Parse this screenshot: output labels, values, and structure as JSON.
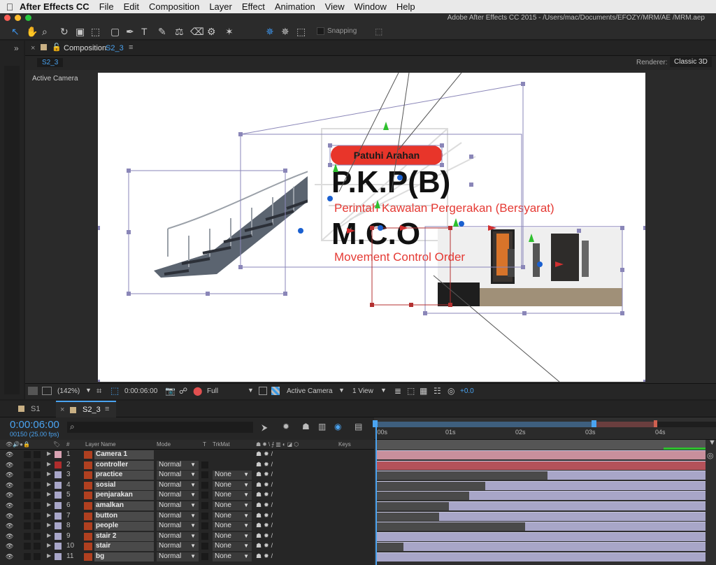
{
  "menubar": {
    "app_name": "After Effects CC",
    "items": [
      "File",
      "Edit",
      "Composition",
      "Layer",
      "Effect",
      "Animation",
      "View",
      "Window",
      "Help"
    ]
  },
  "window": {
    "title": "Adobe After Effects CC 2015 - /Users/mac/Documents/EFOZY/MRM/AE /MRM.aep"
  },
  "toolbar": {
    "snapping_label": "Snapping"
  },
  "composition_panel": {
    "tab_label": "Composition",
    "tab_name": "S2_3",
    "breadcrumb": "S2_3",
    "renderer_label": "Renderer:",
    "renderer_value": "Classic 3D",
    "active_camera_label": "Active Camera"
  },
  "canvas_text": {
    "banner": "Patuhi Arahan",
    "title1": "P.K.P(B)",
    "subtitle1": "Perintah Kawalan Pergerakan (Bersyarat)",
    "title2": "M.C.O",
    "subtitle2": "Movement Control Order"
  },
  "viewer_bar": {
    "zoom": "(142%)",
    "timecode": "0:00:06:00",
    "resolution": "Full",
    "view": "Active Camera",
    "view_count": "1 View",
    "exposure": "+0.0"
  },
  "timeline": {
    "tabs": [
      {
        "label": "S1"
      },
      {
        "label": "S2_3"
      }
    ],
    "current_time": "0:00:06:00",
    "frames_info": "00150 (25.00 fps)",
    "columns": {
      "layer_name": "Layer Name",
      "mode": "Mode",
      "t": "T",
      "trkmat": "TrkMat",
      "keys": "Keys"
    },
    "ruler_labels": [
      ":00s",
      "01s",
      "02s",
      "03s",
      "04s"
    ],
    "layers": [
      {
        "num": "1",
        "name": "Camera 1",
        "mode": "",
        "trkmat": "",
        "label_color": "#d9a3b3",
        "start": 0.0,
        "end": 1.0,
        "bar_color": "#c88f9c"
      },
      {
        "num": "2",
        "name": "controller",
        "mode": "Normal",
        "trkmat": "",
        "label_color": "#b02d2d",
        "start": 0.0,
        "end": 1.0,
        "bar_color": "#b4525a"
      },
      {
        "num": "3",
        "name": "practice",
        "mode": "Normal",
        "trkmat": "None",
        "label_color": "#a8a6c8",
        "start": 0.52,
        "end": 1.0,
        "bar_color": "#a8a6c8"
      },
      {
        "num": "4",
        "name": "sosial",
        "mode": "Normal",
        "trkmat": "None",
        "label_color": "#a8a6c8",
        "start": 0.33,
        "end": 1.0,
        "bar_color": "#a8a6c8"
      },
      {
        "num": "5",
        "name": "penjarakan",
        "mode": "Normal",
        "trkmat": "None",
        "label_color": "#a8a6c8",
        "start": 0.28,
        "end": 1.0,
        "bar_color": "#a8a6c8"
      },
      {
        "num": "6",
        "name": "amalkan",
        "mode": "Normal",
        "trkmat": "None",
        "label_color": "#a8a6c8",
        "start": 0.22,
        "end": 1.0,
        "bar_color": "#a8a6c8"
      },
      {
        "num": "7",
        "name": "button",
        "mode": "Normal",
        "trkmat": "None",
        "label_color": "#a8a6c8",
        "start": 0.19,
        "end": 1.0,
        "bar_color": "#a8a6c8"
      },
      {
        "num": "8",
        "name": "people",
        "mode": "Normal",
        "trkmat": "None",
        "label_color": "#a8a6c8",
        "start": 0.45,
        "end": 1.0,
        "bar_color": "#a8a6c8"
      },
      {
        "num": "9",
        "name": "stair 2",
        "mode": "Normal",
        "trkmat": "None",
        "label_color": "#a8a6c8",
        "start": 0.0,
        "end": 1.0,
        "bar_color": "#a8a6c8"
      },
      {
        "num": "10",
        "name": "stair",
        "mode": "Normal",
        "trkmat": "None",
        "label_color": "#a8a6c8",
        "start": 0.08,
        "end": 1.0,
        "bar_color": "#a8a6c8"
      },
      {
        "num": "11",
        "name": "bg",
        "mode": "Normal",
        "trkmat": "None",
        "label_color": "#a8a6c8",
        "start": 0.0,
        "end": 1.0,
        "bar_color": "#a8a6c8"
      }
    ]
  }
}
